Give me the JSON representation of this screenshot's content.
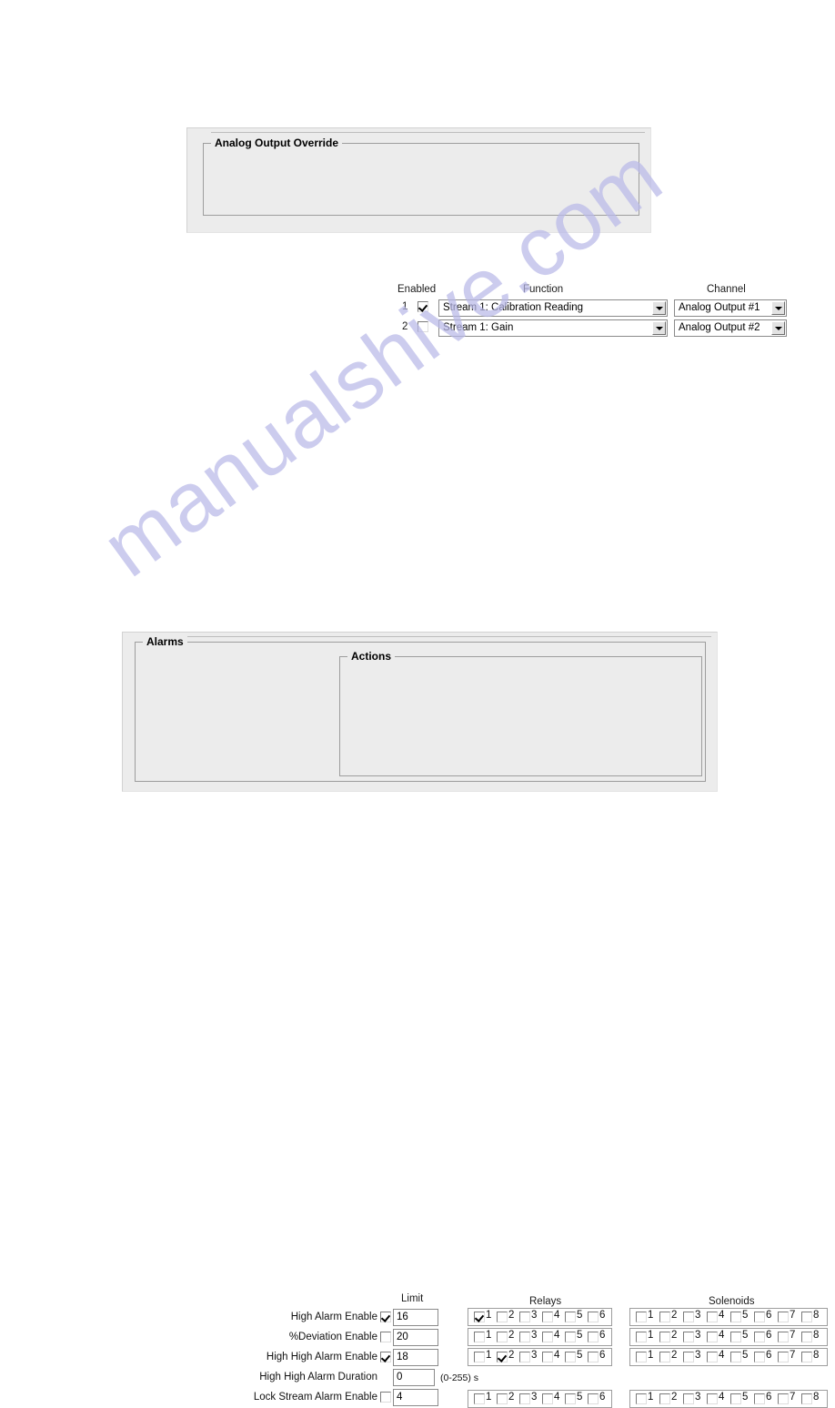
{
  "watermark": {
    "text": "manualshive.com"
  },
  "analog_output_panel": {
    "title": "Analog Output Override",
    "headers": {
      "enabled": "Enabled",
      "function": "Function",
      "channel": "Channel"
    },
    "rows": [
      {
        "index": "1",
        "enabled": true,
        "function": "Stream 1: Calibration Reading",
        "channel": "Analog Output #1"
      },
      {
        "index": "2",
        "enabled": false,
        "function": "Stream 1: Gain",
        "channel": "Analog Output #2"
      }
    ]
  },
  "alarms_panel": {
    "title": "Alarms",
    "limit_header": "Limit",
    "duration_unit": "(0-255) s",
    "rows": [
      {
        "label": "High Alarm Enable",
        "has_checkbox": true,
        "checked": true,
        "limit": "16"
      },
      {
        "label": "%Deviation Enable",
        "has_checkbox": true,
        "checked": false,
        "limit": "20"
      },
      {
        "label": "High High Alarm Enable",
        "has_checkbox": true,
        "checked": true,
        "limit": "18"
      },
      {
        "label": "High High Alarm Duration",
        "has_checkbox": false,
        "checked": false,
        "limit": "0"
      },
      {
        "label": "Lock Stream Alarm Enable",
        "has_checkbox": true,
        "checked": false,
        "limit": "4"
      }
    ],
    "actions": {
      "title": "Actions",
      "relays_header": "Relays",
      "solenoids_header": "Solenoids",
      "relay_numbers": [
        "1",
        "2",
        "3",
        "4",
        "5",
        "6"
      ],
      "solenoid_numbers": [
        "1",
        "2",
        "3",
        "4",
        "5",
        "6",
        "7",
        "8"
      ],
      "relay_rows": [
        {
          "checked": [
            true,
            false,
            false,
            false,
            false,
            false
          ]
        },
        {
          "checked": [
            false,
            false,
            false,
            false,
            false,
            false
          ]
        },
        {
          "checked": [
            false,
            true,
            false,
            false,
            false,
            false
          ]
        },
        {
          "checked": [
            false,
            false,
            false,
            false,
            false,
            false
          ]
        }
      ],
      "solenoid_rows": [
        {
          "checked": [
            false,
            false,
            false,
            false,
            false,
            false,
            false,
            false
          ]
        },
        {
          "checked": [
            false,
            false,
            false,
            false,
            false,
            false,
            false,
            false
          ]
        },
        {
          "checked": [
            false,
            false,
            false,
            false,
            false,
            false,
            false,
            false
          ]
        },
        {
          "checked": [
            false,
            false,
            false,
            false,
            false,
            false,
            false,
            false
          ]
        }
      ]
    }
  }
}
